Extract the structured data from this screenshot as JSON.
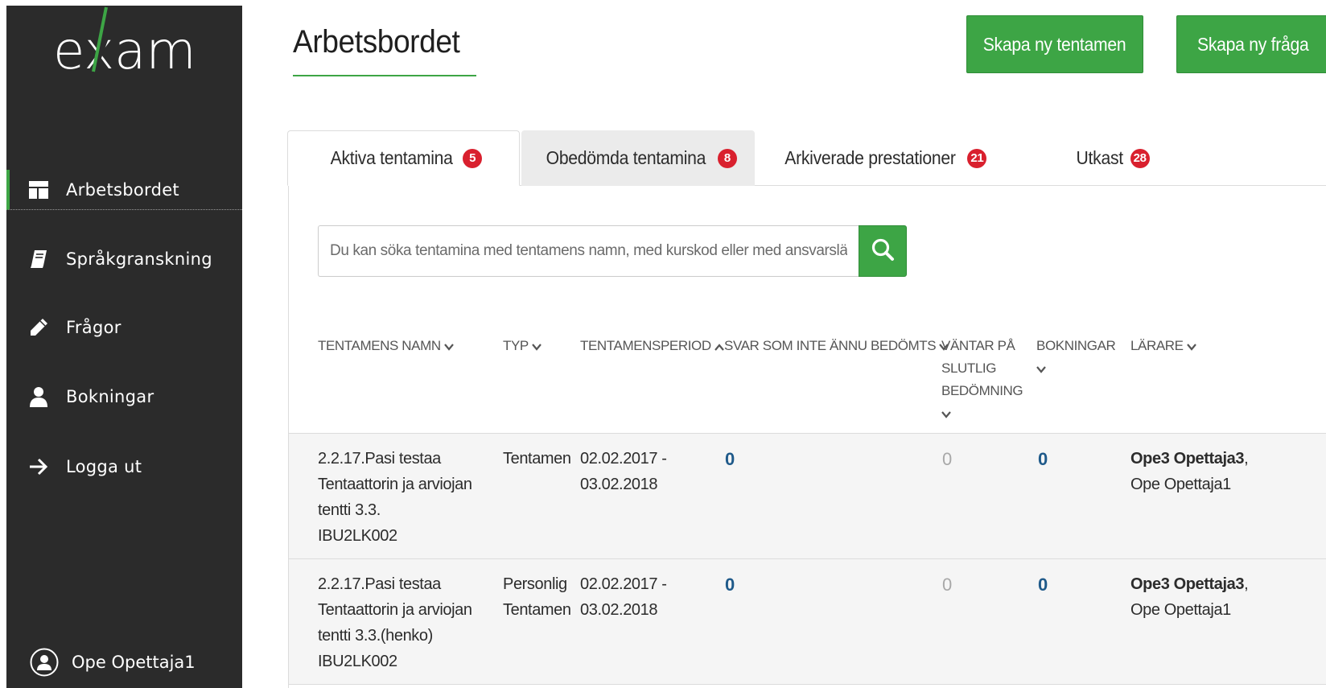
{
  "sidebar": {
    "logo_text": "exam",
    "items": [
      {
        "label": "Arbetsbordet",
        "icon": "dashboard-icon",
        "active": true
      },
      {
        "label": "Språkgranskning",
        "icon": "book-icon",
        "active": false
      },
      {
        "label": "Frågor",
        "icon": "pencil-icon",
        "active": false
      },
      {
        "label": "Bokningar",
        "icon": "user-icon",
        "active": false
      },
      {
        "label": "Logga ut",
        "icon": "arrow-right-icon",
        "active": false
      }
    ],
    "user_name": "Ope Opettaja1"
  },
  "header": {
    "title": "Arbetsbordet",
    "new_exam_button": "Skapa ny tentamen",
    "new_question_button": "Skapa ny fråga"
  },
  "tabs": [
    {
      "label": "Aktiva tentamina",
      "count": "5"
    },
    {
      "label": "Obedömda tentamina",
      "count": "8"
    },
    {
      "label": "Arkiverade prestationer",
      "count": "21"
    },
    {
      "label": "Utkast",
      "count": "28"
    }
  ],
  "search": {
    "placeholder": "Du kan söka tentamina med tentamens namn, med kurskod eller med ansvarslärarens namn",
    "value": ""
  },
  "table": {
    "columns": [
      {
        "label": "TENTAMENS NAMN",
        "sort": "down"
      },
      {
        "label": "TYP",
        "sort": "down"
      },
      {
        "label": "TENTAMENSPERIOD",
        "sort": "up"
      },
      {
        "label": "SVAR SOM INTE ÄNNU BEDÖMTS",
        "sort": "down"
      },
      {
        "label_lines": [
          "VÄNTAR PÅ",
          "SLUTLIG",
          "BEDÖMNING"
        ],
        "sort": "down"
      },
      {
        "label": "BOKNINGAR",
        "sort": "down"
      },
      {
        "label": "LÄRARE",
        "sort": "down"
      }
    ],
    "rows": [
      {
        "name_lines": [
          "2.2.17.Pasi testaa",
          "Tentaattorin ja arviojan",
          "tentti 3.3."
        ],
        "code": "IBU2LK002",
        "type_lines": [
          "Tentamen"
        ],
        "period_lines": [
          "02.02.2017 -",
          "03.02.2018"
        ],
        "unassessed": "0",
        "awaiting_final": "0",
        "bookings": "0",
        "teacher_primary": "Ope3 Opettaja3",
        "teacher_secondary": "Ope Opettaja1"
      },
      {
        "name_lines": [
          "2.2.17.Pasi testaa",
          "Tentaattorin ja arviojan",
          "tentti 3.3.(henko)"
        ],
        "code": "IBU2LK002",
        "type_lines": [
          "Personlig",
          "Tentamen"
        ],
        "period_lines": [
          "02.02.2017 -",
          "03.02.2018"
        ],
        "unassessed": "0",
        "awaiting_final": "0",
        "bookings": "0",
        "teacher_primary": "Ope3 Opettaja3",
        "teacher_secondary": "Ope Opettaja1"
      }
    ]
  },
  "colors": {
    "accent_green": "#3da545",
    "sidebar_bg": "#2b2b2b",
    "badge_red": "#d9202e",
    "number_blue": "#1f5a8a"
  }
}
